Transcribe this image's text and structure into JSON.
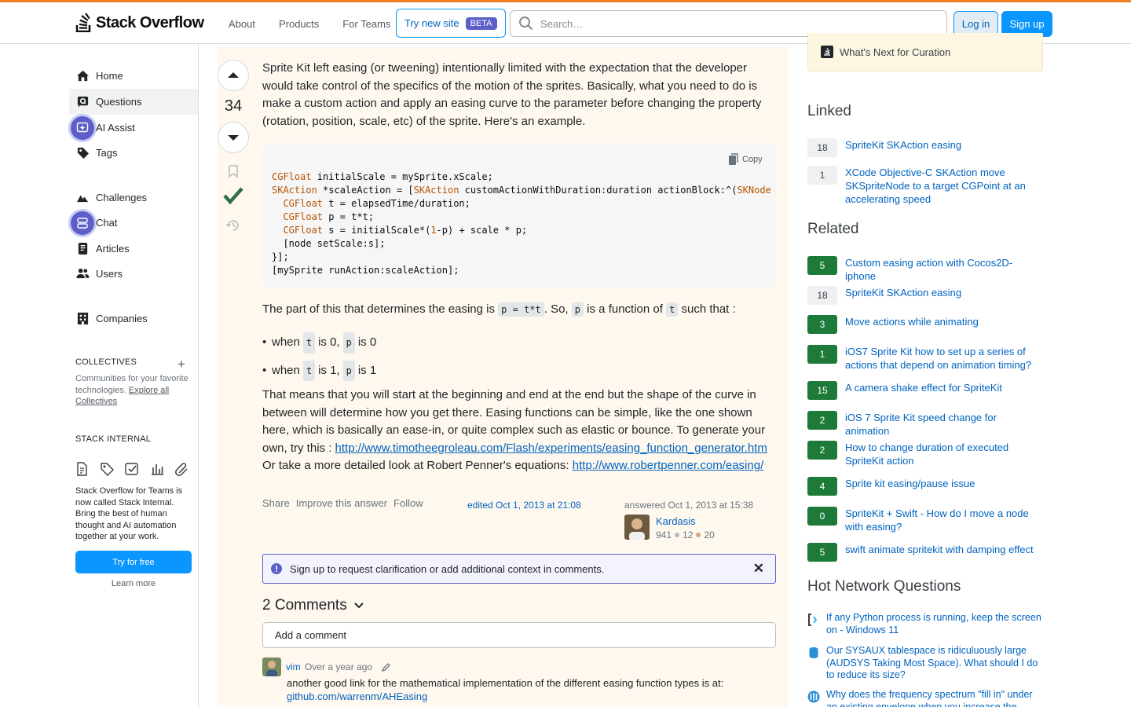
{
  "header": {
    "logo_text": "Stack Overflow",
    "nav": [
      "About",
      "Products",
      "For Teams"
    ],
    "try_new_site": "Try new site",
    "beta_badge": "BETA",
    "search_placeholder": "Search…",
    "login": "Log in",
    "signup": "Sign up",
    "accent_color": "#f48225"
  },
  "sidebar": {
    "items": [
      {
        "label": "Home",
        "icon": "home-icon"
      },
      {
        "label": "Questions",
        "icon": "questions-icon",
        "active": true
      },
      {
        "label": "AI Assist",
        "icon": "ai-assist-icon"
      },
      {
        "label": "Tags",
        "icon": "tag-icon"
      },
      {
        "label": "Challenges",
        "icon": "challenges-icon"
      },
      {
        "label": "Chat",
        "icon": "chat-icon"
      },
      {
        "label": "Articles",
        "icon": "articles-icon"
      },
      {
        "label": "Users",
        "icon": "users-icon"
      },
      {
        "label": "Companies",
        "icon": "companies-icon"
      }
    ],
    "collectives_title": "COLLECTIVES",
    "collectives_desc": "Communities for your favorite technologies.",
    "collectives_link": "Explore all Collectives",
    "stack_internal_title": "STACK INTERNAL",
    "stack_internal_desc": "Stack Overflow for Teams is now called Stack Internal. Bring the best of human thought and AI automation together at your work.",
    "try_free": "Try for free",
    "learn_more": "Learn more"
  },
  "answer": {
    "vote_count": "34",
    "paragraph1": "Sprite Kit left easing (or tweening) intentionally limited with the expectation that the developer would take control of the specifics of the motion of the sprites. Basically, what you need to do is make a custom action and apply an easing curve to the parameter before changing the property (rotation, position, scale, etc) of the sprite. Here's an example.",
    "copy_label": "Copy",
    "p2_before": "The part of this that determines the easing is ",
    "p2_code1": "p = t*t",
    "p2_mid1": ". So, ",
    "p2_code2": "p",
    "p2_mid2": " is a function of ",
    "p2_code3": "t",
    "p2_after": " such that :",
    "bullets": [
      {
        "a": "when ",
        "c1": "t",
        "b": " is 0, ",
        "c2": "p",
        "d": " is 0"
      },
      {
        "a": "when ",
        "c1": "t",
        "b": " is 1, ",
        "c2": "p",
        "d": " is 1"
      }
    ],
    "p3_text": "That means that you will start at the beginning and end at the end but the shape of the curve in between will determine how you get there. Easing functions can be simple, like the one shown here, which is basically an ease-in, or quite complex such as elastic or bounce. To generate your own, try this : ",
    "p3_link": "http://www.timotheegroleau.com/Flash/experiments/easing_function_generator.htm",
    "p4_text": "Or take a more detailed look at Robert Penner's equations: ",
    "p4_link": "http://www.robertpenner.com/easing/",
    "menu": [
      "Share",
      "Improve this answer",
      "Follow"
    ],
    "edited": "edited Oct 1, 2013 at 21:08",
    "answered": "answered Oct 1, 2013 at 15:38",
    "author": "Kardasis",
    "author_rep": "941",
    "author_silver": "12",
    "author_bronze": "20",
    "notice": "Sign up to request clarification or add additional context in comments.",
    "comments_title": "2 Comments",
    "add_comment": "Add a comment",
    "comment_user": "vim",
    "comment_time": "Over a year ago",
    "comment_text": "another good link for the mathematical implementation of the different easing function types is at:",
    "comment_link": "github.com/warrenm/AHEasing"
  },
  "right": {
    "curation": "What's Next for Curation",
    "linked_title": "Linked",
    "linked": [
      {
        "count": "18",
        "answered": false,
        "title": "SpriteKit SKAction easing"
      },
      {
        "count": "1",
        "answered": false,
        "title": "XCode Objective-C SKAction move SKSpriteNode to a target CGPoint at an accelerating speed"
      }
    ],
    "related_title": "Related",
    "related": [
      {
        "count": "5",
        "answered": true,
        "title": "Custom easing action with Cocos2D-iphone"
      },
      {
        "count": "18",
        "answered": false,
        "title": "SpriteKit SKAction easing"
      },
      {
        "count": "3",
        "answered": true,
        "title": "Move actions while animating"
      },
      {
        "count": "1",
        "answered": true,
        "title": "iOS7 Sprite Kit how to set up a series of actions that depend on animation timing?"
      },
      {
        "count": "15",
        "answered": true,
        "title": "A camera shake effect for SpriteKit"
      },
      {
        "count": "2",
        "answered": true,
        "title": "iOS 7 Sprite Kit speed change for animation"
      },
      {
        "count": "2",
        "answered": true,
        "title": "How to change duration of executed SpriteKit action"
      },
      {
        "count": "4",
        "answered": true,
        "title": "Sprite kit easing/pause issue"
      },
      {
        "count": "0",
        "answered": true,
        "title": "SpriteKit + Swift - How do I move a node with easing?"
      },
      {
        "count": "5",
        "answered": true,
        "title": "swift animate spritekit with damping effect"
      }
    ],
    "hnq_title": "Hot Network Questions",
    "hnq": [
      {
        "icon": "superuser-icon",
        "title": "If any Python process is running, keep the screen on - Windows 11"
      },
      {
        "icon": "dba-icon",
        "title": "Our SYSAUX tablespace is ridiculuously large (AUDSYS Taking Most Space). What should I do to reduce its size?"
      },
      {
        "icon": "dsp-icon",
        "title": "Why does the frequency spectrum \"fill in\" under an existing envelope when you increase the period to..."
      }
    ]
  }
}
